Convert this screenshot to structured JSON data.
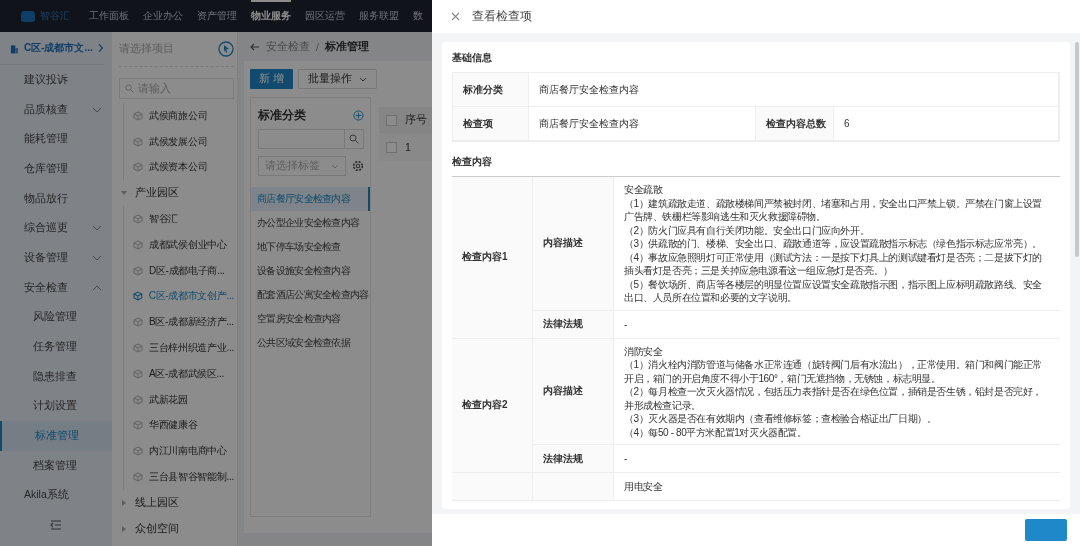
{
  "top_nav": {
    "logo": "智谷汇",
    "items": [
      {
        "label": "工作面板",
        "selected": false
      },
      {
        "label": "企业办公",
        "selected": false
      },
      {
        "label": "资产管理",
        "selected": false
      },
      {
        "label": "物业服务",
        "selected": true
      },
      {
        "label": "园区运营",
        "selected": false
      },
      {
        "label": "服务联盟",
        "selected": false
      },
      {
        "label": "数",
        "selected": false
      }
    ]
  },
  "sidebar": {
    "project": "C区-成都市文...",
    "items": [
      {
        "label": "建议投诉",
        "selected": false
      },
      {
        "label": "品质核查",
        "selected": false,
        "expanded": false
      },
      {
        "label": "能耗管理",
        "selected": false
      },
      {
        "label": "仓库管理",
        "selected": false
      },
      {
        "label": "物品放行",
        "selected": false
      },
      {
        "label": "综合巡更",
        "selected": false,
        "expanded": false
      },
      {
        "label": "设备管理",
        "selected": false,
        "expanded": false
      },
      {
        "label": "安全检查",
        "selected": false,
        "expanded": true,
        "children": [
          {
            "label": "风险管理",
            "selected": false
          },
          {
            "label": "任务管理",
            "selected": false
          },
          {
            "label": "隐患排查",
            "selected": false
          },
          {
            "label": "计划设置",
            "selected": false
          },
          {
            "label": "标准管理",
            "selected": true
          },
          {
            "label": "档案管理",
            "selected": false
          }
        ]
      },
      {
        "label": "Akila系统",
        "selected": false
      }
    ]
  },
  "project_tree": {
    "select": {
      "placeholder": "请选择项目"
    },
    "search": {
      "placeholder": "请输入"
    },
    "nodes": [
      {
        "label": "武侯商旅公司",
        "selected": false
      },
      {
        "label": "武侯发展公司",
        "selected": false
      },
      {
        "label": "武侯资本公司",
        "selected": false
      },
      {
        "label": "产业园区",
        "expanded": true,
        "children": [
          {
            "label": "智谷汇",
            "selected": false
          },
          {
            "label": "成都武侯创业中心",
            "selected": false
          },
          {
            "label": "D区-成都电子商...",
            "selected": false
          },
          {
            "label": "C区-成都市文创产...",
            "selected": true
          },
          {
            "label": "B区-成都新经济产...",
            "selected": false
          },
          {
            "label": "三台梓州织造产业...",
            "selected": false
          },
          {
            "label": "A区-成都武侯区...",
            "selected": false
          },
          {
            "label": "武新花园",
            "selected": false
          },
          {
            "label": "华西健康谷",
            "selected": false
          },
          {
            "label": "内江川南电商中心",
            "selected": false
          },
          {
            "label": "三台县智谷智能制...",
            "selected": false
          }
        ]
      },
      {
        "label": "线上园区",
        "expanded": false
      },
      {
        "label": "众创空间",
        "expanded": false
      }
    ]
  },
  "main": {
    "breadcrumb": {
      "parent": "安全检查",
      "separator": "/",
      "current": "标准管理"
    },
    "buttons": [
      {
        "label": "新 增",
        "kind": "primary"
      },
      {
        "label": "批量操作",
        "kind": "dropdown"
      }
    ],
    "categories": {
      "title": "标准分类",
      "tag_select": {
        "placeholder": "请选择标签"
      },
      "items": [
        {
          "label": "商店餐厅安全检查内容",
          "selected": true
        },
        {
          "label": "办公型企业安全检查内容",
          "selected": false
        },
        {
          "label": "地下停车场安全检查",
          "selected": false
        },
        {
          "label": "设备设施安全检查内容",
          "selected": false
        },
        {
          "label": "配套酒店公寓安全检查内容",
          "selected": false
        },
        {
          "label": "空置房安全检查内容",
          "selected": false
        },
        {
          "label": "公共区域安全检查依据",
          "selected": false
        }
      ]
    },
    "table": {
      "columns": [
        "序号"
      ],
      "header_checked": false,
      "rows": [
        {
          "index": "1",
          "checked": false
        }
      ]
    }
  },
  "drawer": {
    "title": "查看检查项",
    "basic_info": {
      "heading": "基础信息",
      "fields": [
        {
          "label": "标准分类",
          "value": "商店餐厅安全检查内容"
        },
        {
          "label": "检查项",
          "value": "商店餐厅安全检查内容"
        },
        {
          "label": "检查内容总数",
          "value": "6"
        }
      ]
    },
    "content": {
      "heading": "检查内容",
      "items": [
        {
          "title": "检查内容1",
          "desc_label": "内容描述",
          "description": [
            "安全疏散",
            "（1）建筑疏散走道、疏散楼梯间严禁被封闭、堵塞和占用，安全出口严禁上锁。严禁在门窗上设置广告牌、铁栅栏等影响逃生和灭火救援障碍物。",
            "（2）防火门应具有自行关闭功能。安全出口门应向外开。",
            "（3）供疏散的门、楼梯、安全出口、疏散通道等，应设置疏散指示标志（绿色指示标志应常亮）。",
            "（4）事故应急照明灯可正常使用（测试方法：一是按下灯具上的测试键看灯是否亮；二是拔下灯的插头看灯是否亮；三是关掉应急电源看这一组应急灯是否亮。）",
            "（5）餐饮场所、商店等各楼层的明显位置应设置安全疏散指示图，指示图上应标明疏散路线、安全出口、人员所在位置和必要的文字说明。"
          ],
          "law_label": "法律法规",
          "law": "-"
        },
        {
          "title": "检查内容2",
          "desc_label": "内容描述",
          "description": [
            "消防安全",
            "（1）消火栓内消防管道与储备水正常连通（旋转阀门后有水流出），正常使用。箱门和阀门能正常开启，箱门的开启角度不得小于160°，箱门无遮挡物，无锈蚀，标志明显。",
            "（2）每月检查一次灭火器情况，包括压力表指针是否在绿色位置，插销是否生锈，铅封是否完好，并形成检查记录。",
            "（3）灭火器是否在有效期内（查看维修标签；查检验合格证出厂日期）。",
            "（4）每50 - 80平方米配置1对灭火器配置。"
          ],
          "law_label": "法律法规",
          "law": "-"
        },
        {
          "description": [
            "用电安全"
          ]
        }
      ]
    }
  }
}
